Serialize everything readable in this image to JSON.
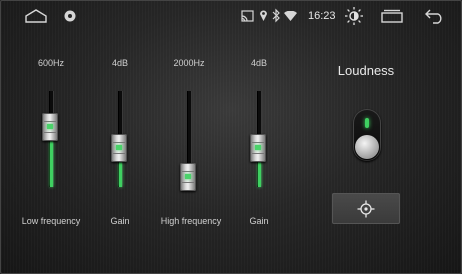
{
  "statusbar": {
    "time": "16:23"
  },
  "bands": [
    {
      "value_label": "600Hz",
      "name": "Low frequency",
      "level": 0.62
    },
    {
      "value_label": "4dB",
      "name": "Gain",
      "level": 0.41
    },
    {
      "value_label": "2000Hz",
      "name": "High frequency",
      "level": 0.1
    },
    {
      "value_label": "4dB",
      "name": "Gain",
      "level": 0.41
    }
  ],
  "loudness": {
    "title": "Loudness",
    "enabled": true
  },
  "colors": {
    "accent": "#3fd061",
    "background": "#262626"
  },
  "icons": {
    "reset": "crosshair-icon"
  }
}
